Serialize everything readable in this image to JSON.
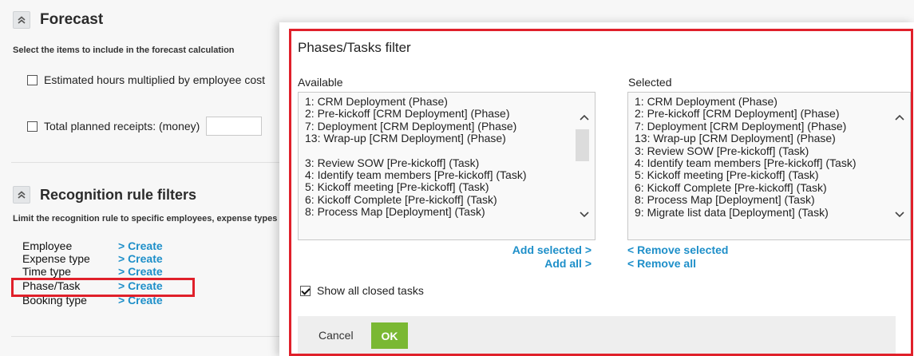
{
  "forecast": {
    "title": "Forecast",
    "description": "Select the items to include in the forecast calculation",
    "option_hours": "Estimated hours multiplied by employee cost",
    "option_receipts": "Total planned receipts: (money)"
  },
  "recognition": {
    "title": "Recognition rule filters",
    "description": "Limit the recognition rule to specific employees, expense types",
    "rows": [
      {
        "label": "Employee",
        "link": "> Create"
      },
      {
        "label": "Expense type",
        "link": "> Create"
      },
      {
        "label": "Time type",
        "link": "> Create"
      },
      {
        "label": "Phase/Task",
        "link": "> Create"
      },
      {
        "label": "Booking type",
        "link": "> Create"
      }
    ]
  },
  "dialog": {
    "title": "Phases/Tasks filter",
    "available_label": "Available",
    "selected_label": "Selected",
    "available_items": [
      "1: CRM Deployment (Phase)",
      "2: Pre-kickoff [CRM Deployment] (Phase)",
      "7: Deployment [CRM Deployment] (Phase)",
      "13: Wrap-up [CRM Deployment] (Phase)",
      "3: Review SOW [Pre-kickoff] (Task)",
      "4: Identify team members [Pre-kickoff] (Task)",
      "5: Kickoff meeting [Pre-kickoff] (Task)",
      "6: Kickoff Complete [Pre-kickoff] (Task)",
      "8: Process Map [Deployment] (Task)"
    ],
    "selected_items": [
      "1: CRM Deployment (Phase)",
      "2: Pre-kickoff [CRM Deployment] (Phase)",
      "7: Deployment [CRM Deployment] (Phase)",
      "13: Wrap-up [CRM Deployment] (Phase)",
      "3: Review SOW [Pre-kickoff] (Task)",
      "4: Identify team members [Pre-kickoff] (Task)",
      "5: Kickoff meeting [Pre-kickoff] (Task)",
      "6: Kickoff Complete [Pre-kickoff] (Task)",
      "8: Process Map [Deployment] (Task)",
      "9: Migrate list data [Deployment] (Task)"
    ],
    "add_selected": "Add selected >",
    "add_all": "Add all >",
    "remove_selected": "< Remove selected",
    "remove_all": "< Remove all",
    "show_closed_label": "Show all closed tasks",
    "show_closed_checked": true,
    "cancel_label": "Cancel",
    "ok_label": "OK"
  },
  "colors": {
    "link": "#1e8fc9",
    "highlight_border": "#e0202a",
    "ok_button": "#7ab833"
  }
}
